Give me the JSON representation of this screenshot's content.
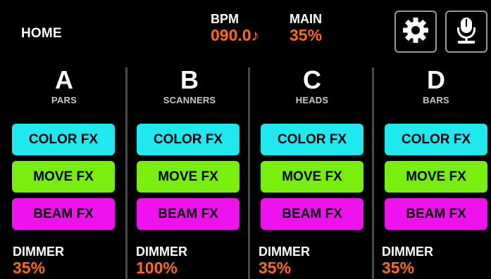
{
  "header": {
    "home_label": "HOME",
    "bpm_label": "BPM",
    "bpm_value": "090.0♪",
    "main_label": "MAIN",
    "main_value": "35%",
    "settings_icon": "gear-icon",
    "mic_icon": "microphone-icon"
  },
  "groups": [
    {
      "letter": "A",
      "name": "PARS",
      "color_fx": "COLOR FX",
      "move_fx": "MOVE FX",
      "beam_fx": "BEAM FX",
      "dimmer_label": "DIMMER",
      "dimmer_value": "35%"
    },
    {
      "letter": "B",
      "name": "SCANNERS",
      "color_fx": "COLOR FX",
      "move_fx": "MOVE FX",
      "beam_fx": "BEAM FX",
      "dimmer_label": "DIMMER",
      "dimmer_value": "100%"
    },
    {
      "letter": "C",
      "name": "HEADS",
      "color_fx": "COLOR FX",
      "move_fx": "MOVE FX",
      "beam_fx": "BEAM FX",
      "dimmer_label": "DIMMER",
      "dimmer_value": "35%"
    },
    {
      "letter": "D",
      "name": "BARS",
      "color_fx": "COLOR FX",
      "move_fx": "MOVE FX",
      "beam_fx": "BEAM FX",
      "dimmer_label": "DIMMER",
      "dimmer_value": "35%"
    }
  ],
  "colors": {
    "background": "#000000",
    "accent_orange": "#ff6a13",
    "color_fx": "#1fe9ee",
    "move_fx": "#78ee0f",
    "beam_fx": "#ee12ee"
  }
}
